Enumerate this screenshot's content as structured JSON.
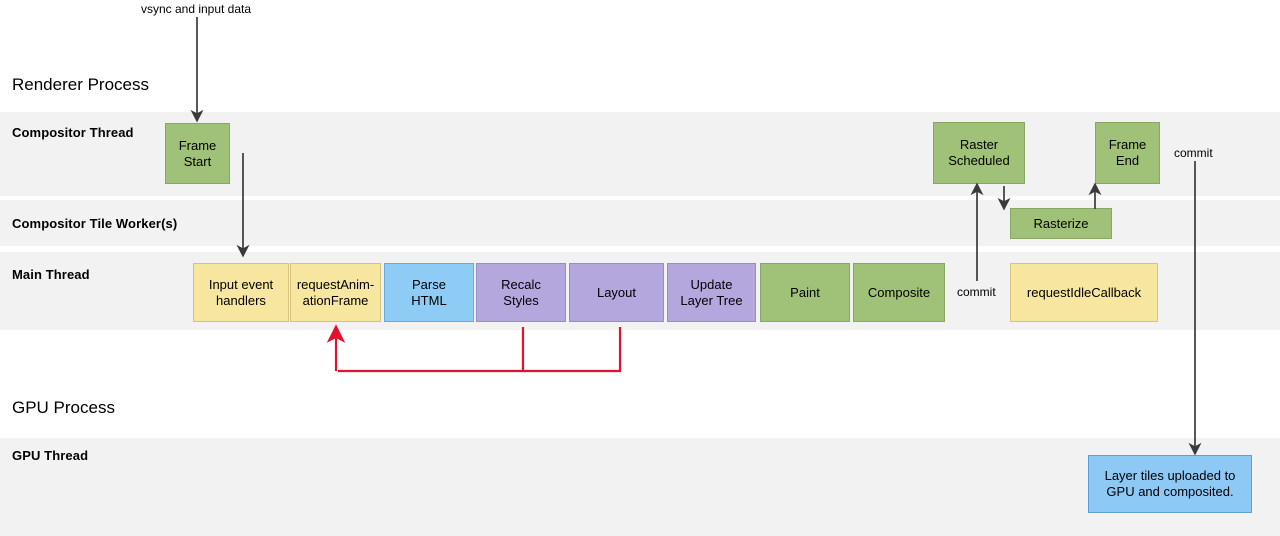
{
  "diagram": {
    "top_label": "vsync and input data",
    "processes": [
      {
        "id": "renderer",
        "title": "Renderer Process"
      },
      {
        "id": "gpu",
        "title": "GPU Process"
      }
    ],
    "lanes": [
      {
        "id": "compositor-thread",
        "label": "Compositor Thread"
      },
      {
        "id": "compositor-tile-worker",
        "label": "Compositor Tile Worker(s)"
      },
      {
        "id": "main-thread",
        "label": "Main Thread"
      },
      {
        "id": "gpu-thread",
        "label": "GPU Thread"
      }
    ],
    "compositor_thread_boxes": [
      {
        "id": "frame-start",
        "label": "Frame\nStart",
        "line1": "Frame",
        "line2": "Start",
        "color": "#a0c178"
      },
      {
        "id": "raster-scheduled",
        "label": "Raster Scheduled",
        "line1": "Raster",
        "line2": "Scheduled",
        "color": "#a0c178"
      },
      {
        "id": "frame-end",
        "label": "Frame End",
        "line1": "Frame",
        "line2": "End",
        "color": "#a0c178"
      }
    ],
    "tile_worker_boxes": [
      {
        "id": "rasterize",
        "label": "Rasterize",
        "color": "#a0c178"
      }
    ],
    "main_thread_boxes": [
      {
        "id": "input-event-handlers",
        "line1": "Input event",
        "line2": "handlers",
        "color": "#f6e6a0"
      },
      {
        "id": "request-animation-frame",
        "line1": "requestAnim-",
        "line2": "ationFrame",
        "color": "#f6e6a0"
      },
      {
        "id": "parse-html",
        "line1": "Parse",
        "line2": "HTML",
        "color": "#8ecbf5"
      },
      {
        "id": "recalc-styles",
        "line1": "Recalc",
        "line2": "Styles",
        "color": "#b4a7dd"
      },
      {
        "id": "layout",
        "line1": "Layout",
        "line2": "",
        "color": "#b4a7dd"
      },
      {
        "id": "update-layer-tree",
        "line1": "Update",
        "line2": "Layer Tree",
        "color": "#b4a7dd"
      },
      {
        "id": "paint",
        "line1": "Paint",
        "line2": "",
        "color": "#a0c178"
      },
      {
        "id": "composite",
        "line1": "Composite",
        "line2": "",
        "color": "#a0c178"
      },
      {
        "id": "request-idle-callback",
        "line1": "requestIdleCallback",
        "line2": "",
        "color": "#f6e6a0"
      }
    ],
    "gpu_thread_boxes": [
      {
        "id": "layer-tiles",
        "line1": "Layer tiles uploaded to",
        "line2": "GPU and composited.",
        "color": "#8ec8f5"
      }
    ],
    "annotations": [
      {
        "id": "commit-left",
        "text": "commit"
      },
      {
        "id": "commit-right",
        "text": "commit"
      }
    ],
    "colors": {
      "band": "#f2f2f2",
      "green": "#a0c178",
      "yellow": "#f6e6a0",
      "blue": "#8ecbf5",
      "purple": "#b4a7dd",
      "lightblue": "#8ec8f5",
      "arrow": "#3a3a3a",
      "loop": "#e3112d"
    }
  }
}
